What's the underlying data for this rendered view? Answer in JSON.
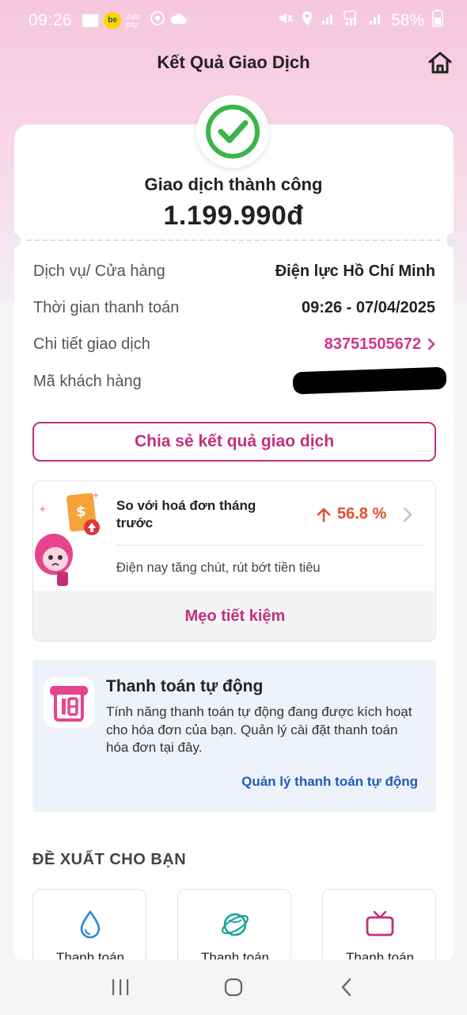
{
  "status_bar": {
    "time": "09:26",
    "battery": "58%",
    "icons": [
      "notification-app-icon",
      "be-app-icon",
      "zalopay-icon",
      "sync-icon",
      "cloud-icon",
      "mute-icon",
      "location-icon",
      "signal-icon",
      "5g-icon",
      "signal-icon",
      "battery-icon"
    ],
    "be_label": "be",
    "zalo_label": "Zalo pay"
  },
  "header": {
    "title": "Kết Quả Giao Dịch"
  },
  "result": {
    "status": "Giao dịch thành công",
    "amount": "1.199.990đ"
  },
  "details": [
    {
      "label": "Dịch vụ/ Cửa hàng",
      "value": "Điện lực Hồ Chí Minh"
    },
    {
      "label": "Thời gian thanh toán",
      "value": "09:26 - 07/04/2025"
    },
    {
      "label": "Chi tiết giao dịch",
      "value": "83751505672"
    },
    {
      "label": "Mã khách hàng",
      "value": ""
    }
  ],
  "share_button": "Chia sẻ kết quả giao dịch",
  "compare": {
    "title": "So với hoá đơn tháng trước",
    "percent": "56.8 %",
    "subtitle": "Điện nay tăng chút, rút bớt tiền tiêu",
    "tips_button": "Mẹo tiết kiệm"
  },
  "auto_pay": {
    "title": "Thanh toán tự động",
    "description": "Tính năng thanh toán tự động đang được kích hoạt cho hóa đơn của bạn. Quản lý cài đặt thanh toán hóa đơn tại đây.",
    "link": "Quản lý thanh toán tự động"
  },
  "suggestions": {
    "title": "ĐỀ XUẤT CHO BẠN",
    "items": [
      {
        "label": "Thanh toán",
        "icon": "water-drop-icon"
      },
      {
        "label": "Thanh toán",
        "icon": "internet-globe-icon"
      },
      {
        "label": "Thanh toán",
        "icon": "tv-icon"
      }
    ]
  },
  "colors": {
    "brand_pink": "#c2307a",
    "success_green": "#3bb54a",
    "increase_orange": "#e0502d",
    "link_blue": "#1f5bb8"
  }
}
